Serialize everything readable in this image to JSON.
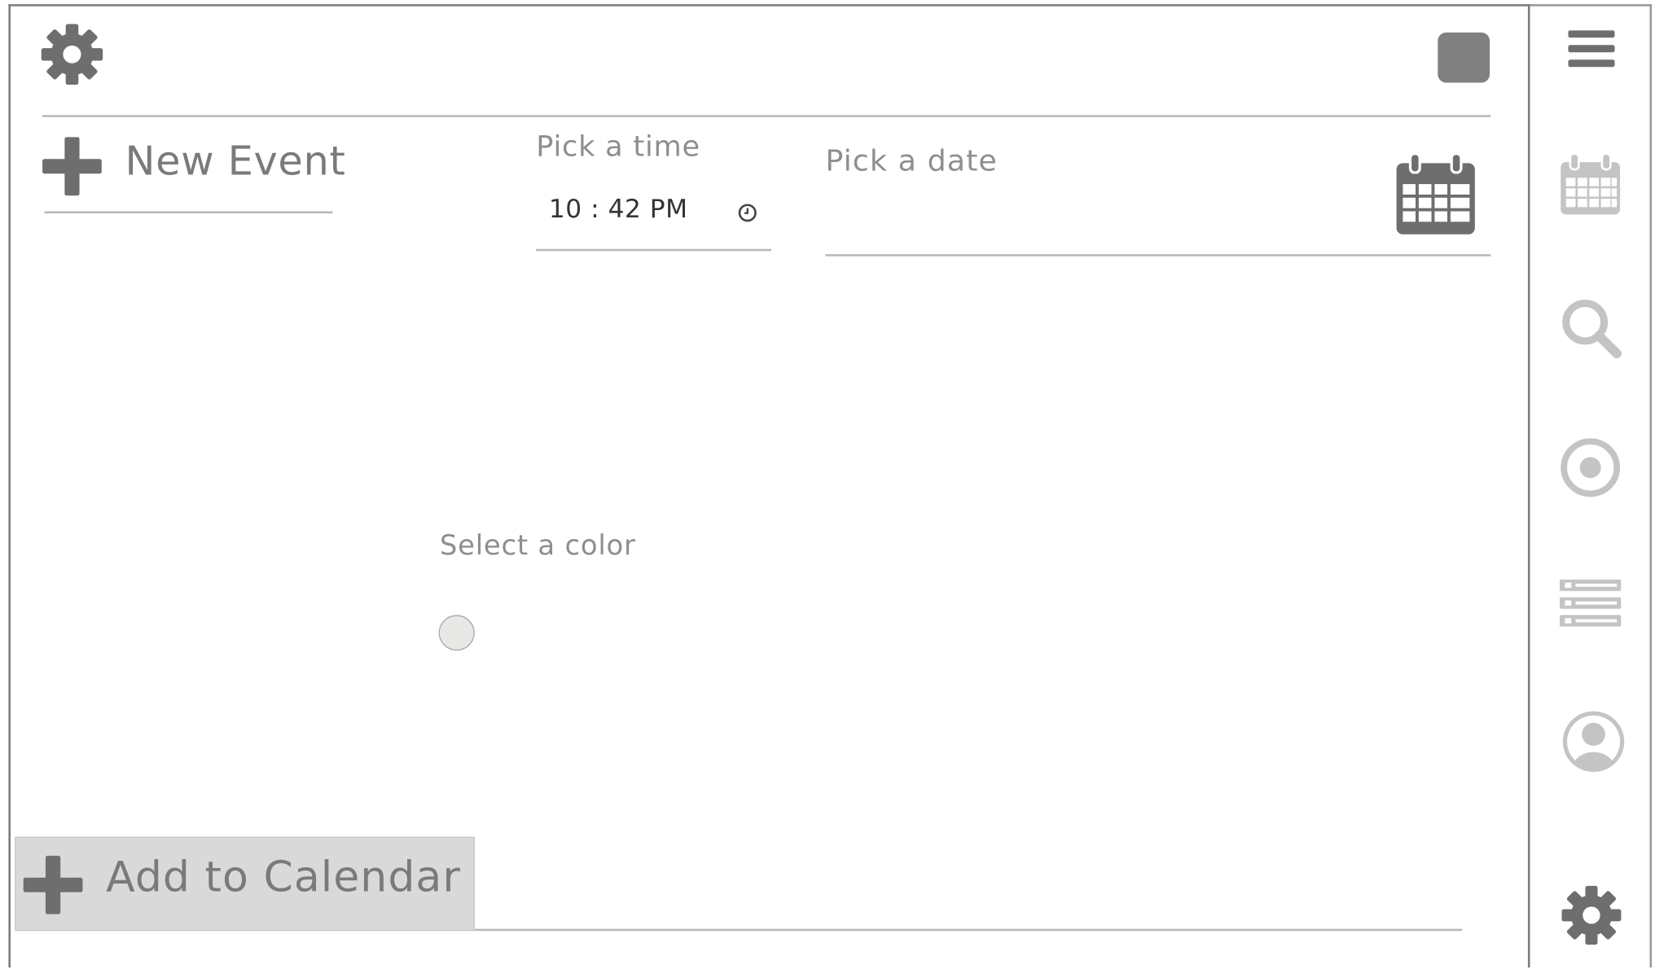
{
  "form": {
    "title": "New Event",
    "time": {
      "label": "Pick a time",
      "value": "10 : 42 PM"
    },
    "date": {
      "label": "Pick a date",
      "value": ""
    },
    "color": {
      "label": "Select a color",
      "selected": "#e8e8e6"
    },
    "submit_label": "Add to Calendar"
  },
  "icons": {
    "header_left": "gear-icon",
    "header_right": "square-button",
    "title": "plus-icon",
    "time_field": "clock-icon",
    "date_field": "calendar-icon",
    "submit": "plus-icon"
  },
  "sidebar": {
    "items": [
      {
        "icon": "hamburger-menu-icon"
      },
      {
        "icon": "calendar-icon"
      },
      {
        "icon": "search-icon"
      },
      {
        "icon": "target-icon"
      },
      {
        "icon": "list-icon"
      },
      {
        "icon": "user-icon"
      },
      {
        "icon": "gear-icon"
      }
    ]
  },
  "colors": {
    "dark_icon": "#6e6e6e",
    "light_icon": "#c4c4c4",
    "button_bg": "#d9d9d9",
    "rule": "#b8b8b8"
  }
}
